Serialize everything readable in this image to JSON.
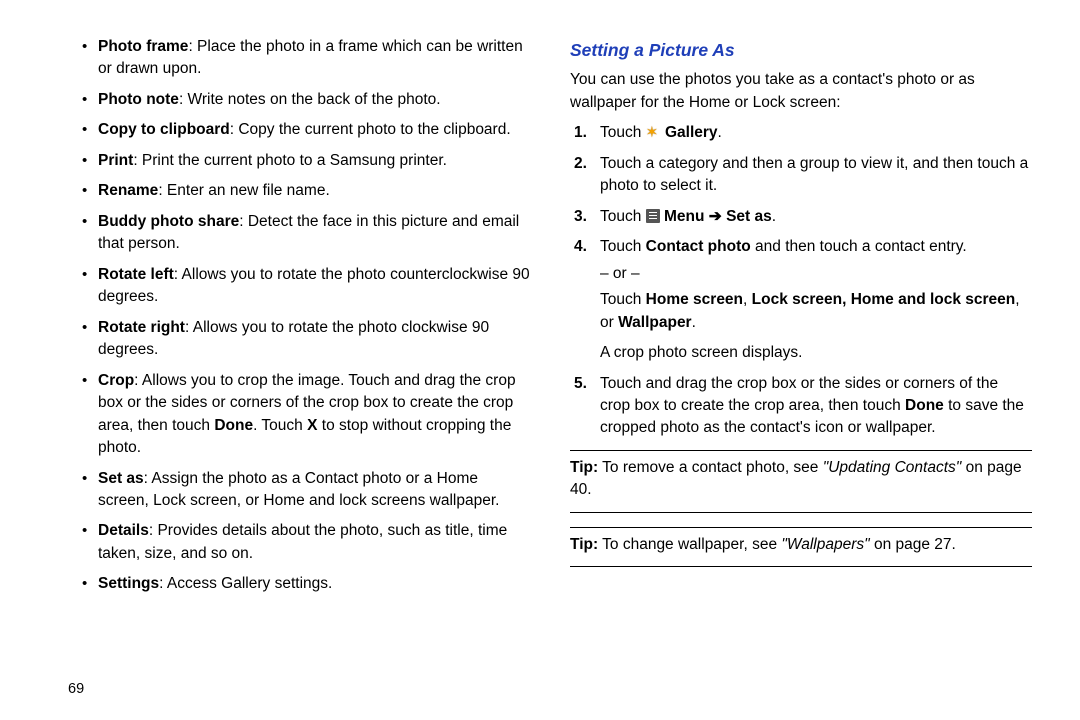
{
  "left": {
    "bullets": [
      {
        "label": "Photo frame",
        "desc": ": Place the photo in a frame which can be written or drawn upon."
      },
      {
        "label": "Photo note",
        "desc": ": Write notes on the back of the photo."
      },
      {
        "label": "Copy to clipboard",
        "desc": ": Copy the current photo to the clipboard."
      },
      {
        "label": "Print",
        "desc": ": Print the current photo to a Samsung printer."
      },
      {
        "label": "Rename",
        "desc": ": Enter an new file name."
      },
      {
        "label": "Buddy photo share",
        "desc": ": Detect the face in this picture and email that person."
      },
      {
        "label": "Rotate left",
        "desc": ": Allows you to rotate the photo counterclockwise 90 degrees."
      },
      {
        "label": "Rotate right",
        "desc": ": Allows you to rotate the photo clockwise 90 degrees."
      }
    ],
    "crop": {
      "label": "Crop",
      "p1": ": Allows you to crop the image. Touch and drag the crop box or the sides or corners of the crop box to create the crop area, then touch ",
      "done": "Done",
      "p2": ". Touch ",
      "x": "X",
      "p3": " to stop without cropping the photo."
    },
    "setas": {
      "label": "Set as",
      "desc": ": Assign the photo as a Contact photo or a Home screen, Lock screen, or Home and lock screens wallpaper."
    },
    "details": {
      "label": "Details",
      "desc": ": Provides details about the photo, such as title, time taken, size, and so on."
    },
    "settings": {
      "label": "Settings",
      "desc": ": Access Gallery settings."
    },
    "page_number": "69"
  },
  "right": {
    "heading": "Setting a Picture As",
    "intro": "You can use the photos you take as a contact's photo or as wallpaper for the Home or Lock screen:",
    "step1_pre": "Touch ",
    "step1_gallery": " Gallery",
    "step1_post": ".",
    "step2": "Touch a category and then a group to view it, and then touch a photo to select it.",
    "step3_touch": "Touch ",
    "step3_menu": " Menu ",
    "step3_arrow": "➔",
    "step3_setas": " Set as",
    "step3_post": ".",
    "step4_pre": "Touch ",
    "step4_contact": "Contact photo",
    "step4_mid": " and then touch a contact entry.",
    "step4_or": "– or –",
    "step4b_pre": "Touch ",
    "step4b_home": "Home screen",
    "step4b_c1": ", ",
    "step4b_lock": "Lock screen, Home and lock screen",
    "step4b_c2": ", or ",
    "step4b_wall": "Wallpaper",
    "step4b_post": ".",
    "step4c": "A crop photo screen displays.",
    "step5_pre": "Touch and drag the crop box or the sides or corners of the crop box to create the crop area, then touch ",
    "step5_done": "Done",
    "step5_post": " to save the cropped photo as the contact's icon or wallpaper.",
    "tip1_lead": "Tip:",
    "tip1_text": " To remove a contact photo, see ",
    "tip1_link": "\"Updating Contacts\"",
    "tip1_post": " on page 40.",
    "tip2_lead": "Tip:",
    "tip2_text": " To change wallpaper, see ",
    "tip2_link": "\"Wallpapers\"",
    "tip2_post": " on page 27."
  }
}
